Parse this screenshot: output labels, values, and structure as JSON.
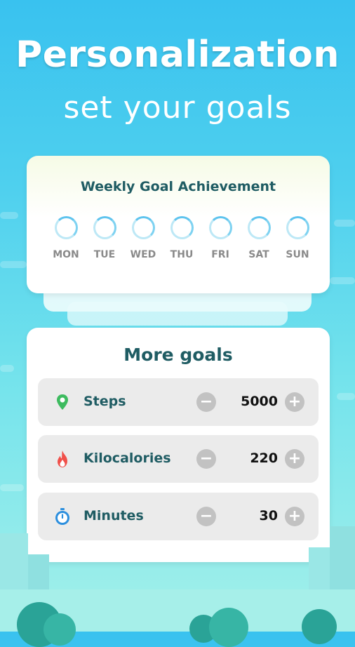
{
  "header": {
    "title": "Personalization",
    "subtitle": "set your goals"
  },
  "weekly": {
    "title": "Weekly Goal Achievement",
    "days": [
      "MON",
      "TUE",
      "WED",
      "THU",
      "FRI",
      "SAT",
      "SUN"
    ]
  },
  "goals": {
    "title": "More goals",
    "items": [
      {
        "label": "Steps",
        "value": "5000",
        "icon": "location-pin-icon",
        "icon_color": "#3dbb5f"
      },
      {
        "label": "Kilocalories",
        "value": "220",
        "icon": "flame-icon",
        "icon_color": "#f0504a"
      },
      {
        "label": "Minutes",
        "value": "30",
        "icon": "stopwatch-icon",
        "icon_color": "#2c8fde"
      }
    ],
    "minus_symbol": "−",
    "plus_symbol": "+"
  },
  "colors": {
    "title_text": "#1f5c63",
    "ring_progress": "#5fc4ee",
    "ring_track": "#bde8f6",
    "button_grey": "#c2c2c2"
  }
}
